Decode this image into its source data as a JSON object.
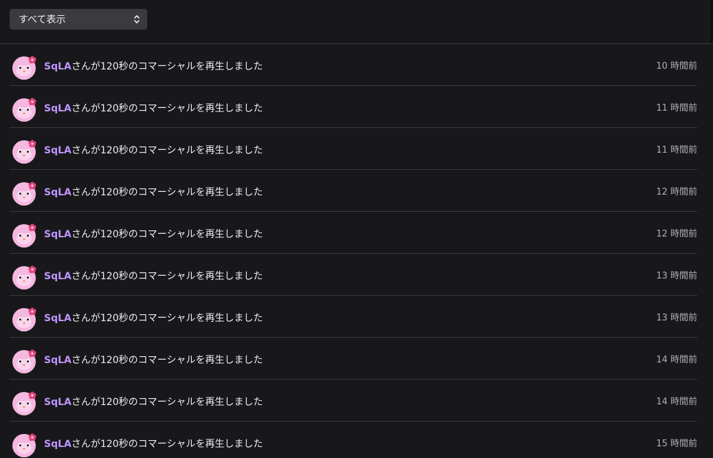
{
  "filter": {
    "selected": "すべて表示"
  },
  "colors": {
    "background": "#18181b",
    "username": "#bf94ff",
    "divider": "#3a3a3d",
    "timestamp": "#adadb8",
    "select_bg": "#3b3b3f"
  },
  "icons": {
    "filter_toggle": "chevron-up-down-icon",
    "avatar": "pink-bird-avatar"
  },
  "activity": [
    {
      "user": "SqLA",
      "text": "さんが120秒のコマーシャルを再生しました",
      "time": "10 時間前"
    },
    {
      "user": "SqLA",
      "text": "さんが120秒のコマーシャルを再生しました",
      "time": "11 時間前"
    },
    {
      "user": "SqLA",
      "text": "さんが120秒のコマーシャルを再生しました",
      "time": "11 時間前"
    },
    {
      "user": "SqLA",
      "text": "さんが120秒のコマーシャルを再生しました",
      "time": "12 時間前"
    },
    {
      "user": "SqLA",
      "text": "さんが120秒のコマーシャルを再生しました",
      "time": "12 時間前"
    },
    {
      "user": "SqLA",
      "text": "さんが120秒のコマーシャルを再生しました",
      "time": "13 時間前"
    },
    {
      "user": "SqLA",
      "text": "さんが120秒のコマーシャルを再生しました",
      "time": "13 時間前"
    },
    {
      "user": "SqLA",
      "text": "さんが120秒のコマーシャルを再生しました",
      "time": "14 時間前"
    },
    {
      "user": "SqLA",
      "text": "さんが120秒のコマーシャルを再生しました",
      "time": "14 時間前"
    },
    {
      "user": "SqLA",
      "text": "さんが120秒のコマーシャルを再生しました",
      "time": "15 時間前"
    }
  ]
}
